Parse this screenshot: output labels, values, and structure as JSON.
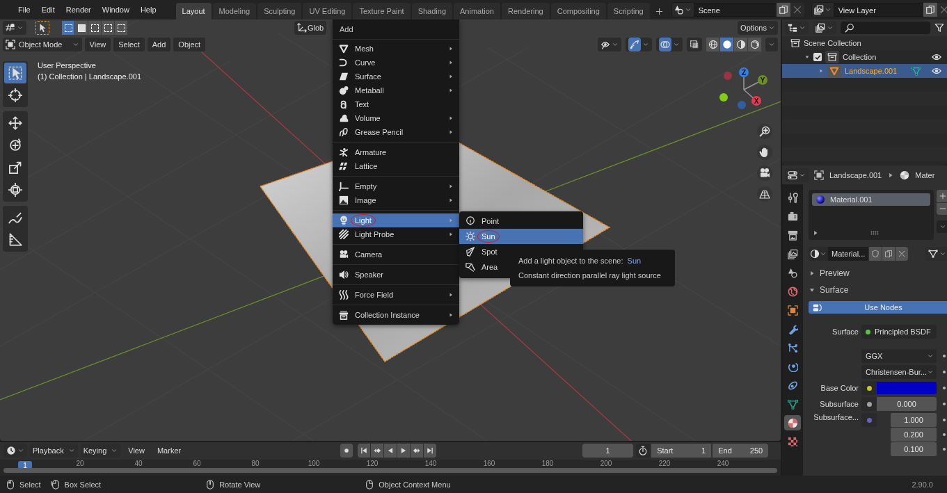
{
  "topbar": {
    "menus": [
      "File",
      "Edit",
      "Render",
      "Window",
      "Help"
    ],
    "workspaces": [
      {
        "label": "Layout",
        "selected": true
      },
      {
        "label": "Modeling",
        "selected": false
      },
      {
        "label": "Sculpting",
        "selected": false
      },
      {
        "label": "UV Editing",
        "selected": false
      },
      {
        "label": "Texture Paint",
        "selected": false
      },
      {
        "label": "Shading",
        "selected": false
      },
      {
        "label": "Animation",
        "selected": false
      },
      {
        "label": "Rendering",
        "selected": false
      },
      {
        "label": "Compositing",
        "selected": false
      },
      {
        "label": "Scripting",
        "selected": false
      }
    ],
    "scene": "Scene",
    "view_layer": "View Layer"
  },
  "viewport": {
    "orientation": "Glob",
    "options": "Options",
    "mode": "Object Mode",
    "menus": [
      "View",
      "Select",
      "Add",
      "Object"
    ],
    "select_modes": [
      {
        "selected": true
      },
      {
        "selected": false
      },
      {
        "selected": false
      },
      {
        "selected": false
      },
      {
        "selected": false
      }
    ],
    "shading": [
      {
        "kind": "wireframe",
        "selected": false
      },
      {
        "kind": "solid",
        "selected": true
      },
      {
        "kind": "material",
        "selected": false
      },
      {
        "kind": "rendered",
        "selected": false
      }
    ],
    "info": [
      "User Perspective",
      "(1) Collection | Landscape.001"
    ],
    "tool_groups": [
      {
        "tools": [
          {
            "kind": "select",
            "selected": true
          },
          {
            "kind": "cursor",
            "selected": false
          }
        ]
      },
      {
        "tools": [
          {
            "kind": "move",
            "selected": false
          },
          {
            "kind": "rotate",
            "selected": false
          },
          {
            "kind": "scale",
            "selected": false
          },
          {
            "kind": "transform",
            "selected": false
          }
        ]
      },
      {
        "tools": [
          {
            "kind": "annotate",
            "selected": false
          },
          {
            "kind": "measure",
            "selected": false
          }
        ]
      }
    ],
    "gizmo": [
      {
        "label": "Z",
        "color": "#2f7fe6"
      },
      {
        "label": "Y",
        "color": "#6b8f22"
      },
      {
        "label": "X",
        "color": "#e53a50"
      }
    ]
  },
  "add_menu": {
    "title": "Add",
    "sections": [
      {
        "items": [
          {
            "label": "Mesh",
            "kind": "mesh",
            "submenu": true,
            "selected": false,
            "circled": false
          },
          {
            "label": "Curve",
            "kind": "curve",
            "submenu": true,
            "selected": false,
            "circled": false
          },
          {
            "label": "Surface",
            "kind": "surface",
            "submenu": true,
            "selected": false,
            "circled": false
          },
          {
            "label": "Metaball",
            "kind": "metaball",
            "submenu": true,
            "selected": false,
            "circled": false
          },
          {
            "label": "Text",
            "kind": "text",
            "submenu": false,
            "selected": false,
            "circled": false
          },
          {
            "label": "Volume",
            "kind": "volume",
            "submenu": true,
            "selected": false,
            "circled": false
          },
          {
            "label": "Grease Pencil",
            "kind": "grease_pencil",
            "submenu": true,
            "selected": false,
            "circled": false
          }
        ]
      },
      {
        "items": [
          {
            "label": "Armature",
            "kind": "armature",
            "submenu": false,
            "selected": false,
            "circled": false
          },
          {
            "label": "Lattice",
            "kind": "lattice",
            "submenu": false,
            "selected": false,
            "circled": false
          }
        ]
      },
      {
        "items": [
          {
            "label": "Empty",
            "kind": "empty",
            "submenu": true,
            "selected": false,
            "circled": false
          },
          {
            "label": "Image",
            "kind": "image",
            "submenu": true,
            "selected": false,
            "circled": false
          }
        ]
      },
      {
        "items": [
          {
            "label": "Light",
            "kind": "light",
            "submenu": true,
            "selected": true,
            "circled": true
          },
          {
            "label": "Light Probe",
            "kind": "light_probe",
            "submenu": true,
            "selected": false,
            "circled": false
          }
        ]
      },
      {
        "items": [
          {
            "label": "Camera",
            "kind": "camera",
            "submenu": false,
            "selected": false,
            "circled": false
          }
        ]
      },
      {
        "items": [
          {
            "label": "Speaker",
            "kind": "speaker",
            "submenu": false,
            "selected": false,
            "circled": false
          }
        ]
      },
      {
        "items": [
          {
            "label": "Force Field",
            "kind": "force_field",
            "submenu": true,
            "selected": false,
            "circled": false
          }
        ]
      },
      {
        "items": [
          {
            "label": "Collection Instance",
            "kind": "collection_instance",
            "submenu": true,
            "selected": false,
            "circled": false
          }
        ]
      }
    ]
  },
  "light_menu": {
    "items": [
      {
        "label": "Point",
        "kind": "point",
        "selected": false,
        "circled": false
      },
      {
        "label": "Sun",
        "kind": "sun",
        "selected": true,
        "circled": true
      },
      {
        "label": "Spot",
        "kind": "spot",
        "selected": false,
        "circled": false
      },
      {
        "label": "Area",
        "kind": "area",
        "selected": false,
        "circled": false
      }
    ]
  },
  "tooltip": {
    "text": "Add a light object to the scene:",
    "value": "Sun",
    "description": "Constant direction parallel ray light source"
  },
  "outliner": {
    "tree": [
      {
        "label": "Scene Collection",
        "kind": "scene_collection",
        "selected": false,
        "children": [
          {
            "label": "Collection",
            "kind": "collection",
            "checked": true,
            "expanded": true,
            "visible": true,
            "selected": false,
            "children": [
              {
                "label": "Landscape.001",
                "kind": "mesh_object",
                "expanded": false,
                "visible": true,
                "selected": true
              }
            ]
          }
        ]
      }
    ]
  },
  "properties": {
    "object": "Landscape.001",
    "context": "Mater",
    "tabs": [
      {
        "kind": "tool",
        "selected": false
      },
      {
        "kind": "render",
        "selected": false
      },
      {
        "kind": "output",
        "selected": false
      },
      {
        "kind": "view_layer",
        "selected": false
      },
      {
        "kind": "scene",
        "selected": false
      },
      {
        "kind": "world",
        "selected": false
      },
      {
        "kind": "object",
        "selected": false
      },
      {
        "kind": "modifier",
        "selected": false
      },
      {
        "kind": "particles",
        "selected": false
      },
      {
        "kind": "physics",
        "selected": false
      },
      {
        "kind": "constraint",
        "selected": false
      },
      {
        "kind": "data",
        "selected": false
      },
      {
        "kind": "material",
        "selected": true
      },
      {
        "kind": "texture",
        "selected": false
      }
    ],
    "material_slots": [
      {
        "label": "Material.001",
        "selected": true
      }
    ],
    "material": "Material...",
    "panels": [
      {
        "title": "Preview",
        "expanded": false
      },
      {
        "title": "Surface",
        "expanded": true
      }
    ],
    "use_nodes": "Use Nodes",
    "fields": [
      {
        "kind": "shader",
        "label": "Surface",
        "value": "Principled BSDF",
        "socket": {
          "color": "#5fbf4a"
        }
      },
      {
        "kind": "menu",
        "value": "GGX"
      },
      {
        "kind": "menu",
        "value": "Christensen-Bur..."
      },
      {
        "kind": "color",
        "label": "Base Color",
        "socket": {
          "color": "#c7c729"
        },
        "color": "#0000c4"
      },
      {
        "kind": "number",
        "label": "Subsurface",
        "socket": {
          "color": "#a1a1a1"
        },
        "value": "0.000"
      },
      {
        "kind": "vector",
        "label": "Subsurface...",
        "socket": {
          "color": "#6363c7"
        },
        "values": [
          "1.000",
          "0.200",
          "0.100"
        ]
      }
    ]
  },
  "timeline": {
    "menus": [
      "Playback",
      "Keying",
      "View",
      "Marker"
    ],
    "frame": "1",
    "start_label": "Start",
    "start": "1",
    "end_label": "End",
    "end": "250",
    "playhead": "1",
    "ruler": [
      "20",
      "40",
      "60",
      "80",
      "100",
      "120",
      "140",
      "160",
      "180",
      "200",
      "220",
      "240"
    ]
  },
  "status_bar": {
    "hints": [
      {
        "label": "Select",
        "kind": "mouse_left"
      },
      {
        "label": "Box Select",
        "kind": "mouse_drag"
      },
      {
        "label": "Rotate View",
        "kind": "mouse_middle"
      },
      {
        "label": "Object Context Menu",
        "kind": "mouse_right"
      }
    ],
    "version": "2.90.0"
  }
}
